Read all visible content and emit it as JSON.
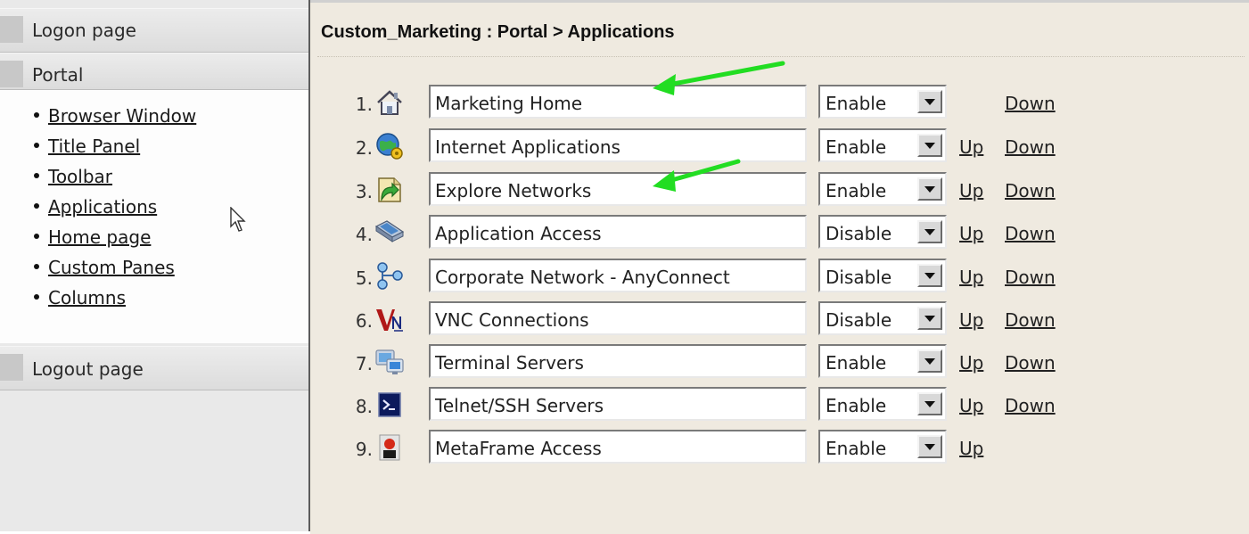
{
  "sidebar": {
    "logon_label": "Logon page",
    "portal_label": "Portal",
    "logout_label": "Logout page",
    "portal_items": [
      {
        "label": "Browser Window"
      },
      {
        "label": "Title Panel"
      },
      {
        "label": "Toolbar"
      },
      {
        "label": "Applications"
      },
      {
        "label": "Home page"
      },
      {
        "label": "Custom Panes"
      },
      {
        "label": "Columns"
      }
    ]
  },
  "main": {
    "title": "Custom_Marketing : Portal > Applications",
    "rows": [
      {
        "num": "1.",
        "icon": "home-icon",
        "name": "Marketing Home",
        "state": "Enable",
        "up": "",
        "down": "Down"
      },
      {
        "num": "2.",
        "icon": "globe-gear-icon",
        "name": "Internet Applications",
        "state": "Enable",
        "up": "Up",
        "down": "Down"
      },
      {
        "num": "3.",
        "icon": "explore-network-icon",
        "name": "Explore Networks",
        "state": "Enable",
        "up": "Up",
        "down": "Down"
      },
      {
        "num": "4.",
        "icon": "application-access-icon",
        "name": "Application Access",
        "state": "Disable",
        "up": "Up",
        "down": "Down"
      },
      {
        "num": "5.",
        "icon": "network-nodes-icon",
        "name": "Corporate Network  - AnyConnect",
        "state": "Disable",
        "up": "Up",
        "down": "Down"
      },
      {
        "num": "6.",
        "icon": "vnc-icon",
        "name": "VNC Connections",
        "state": "Disable",
        "up": "Up",
        "down": "Down"
      },
      {
        "num": "7.",
        "icon": "terminal-server-icon",
        "name": "Terminal Servers",
        "state": "Enable",
        "up": "Up",
        "down": "Down"
      },
      {
        "num": "8.",
        "icon": "telnet-ssh-icon",
        "name": "Telnet/SSH Servers",
        "state": "Enable",
        "up": "Up",
        "down": "Down"
      },
      {
        "num": "9.",
        "icon": "metaframe-icon",
        "name": "MetaFrame Access",
        "state": "Enable",
        "up": "Up",
        "down": ""
      }
    ]
  },
  "colors": {
    "main_bg": "#efeae0",
    "sidebar_bg": "#e9e9e9",
    "annotation_arrow": "#22dd22"
  }
}
